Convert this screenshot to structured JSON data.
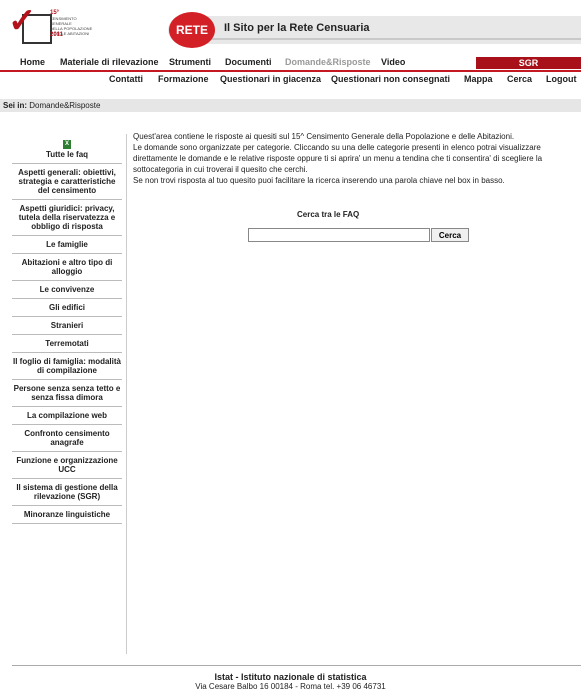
{
  "logo": {
    "top": "15°",
    "line1": "CENSIMENTO GENERALE",
    "line2": "DELLA POPOLAZIONE",
    "line3": "E DELLE ABITAZIONI",
    "year": "2011"
  },
  "site": {
    "rete": "RETE",
    "title": "Il Sito per la Rete Censuaria"
  },
  "nav1": [
    "Home",
    "Materiale di rilevazione",
    "Strumenti",
    "Documenti",
    "Domande&Risposte",
    "Video"
  ],
  "sgr": "SGR",
  "nav2": [
    "Contatti",
    "Formazione",
    "Questionari in giacenza",
    "Questionari non consegnati",
    "Mappa",
    "Cerca",
    "Logout"
  ],
  "breadcrumb": {
    "label": "Sei in:",
    "value": "Domande&Risposte"
  },
  "sidebar": [
    "Tutte le faq",
    "Aspetti generali: obiettivi, strategia e caratteristiche del censimento",
    "Aspetti giuridici: privacy, tutela della riservatezza e obbligo di risposta",
    "Le famiglie",
    "Abitazioni e altro tipo di alloggio",
    "Le convivenze",
    "Gli edifici",
    "Stranieri",
    "Terremotati",
    "Il foglio di famiglia: modalità di compilazione",
    "Persone senza senza tetto e senza fissa dimora",
    "La compilazione web",
    "Confronto censimento anagrafe",
    "Funzione e organizzazione UCC",
    "Il sistema di gestione della rilevazione (SGR)",
    "Minoranze linguistiche"
  ],
  "content": {
    "p1": "Quest'area contiene le risposte ai quesiti sul 15^ Censimento Generale della Popolazione e delle Abitazioni.",
    "p2": "Le domande sono organizzate per categorie. Cliccando su una delle categorie presenti in elenco potrai visualizzare",
    "p3": "direttamente le domande e le relative risposte oppure ti si aprira' un menu a tendina che ti consentira' di scegliere la",
    "p4": "sottocategoria in cui troverai il quesito che cerchi.",
    "p5": "Se non trovi risposta al tuo quesito puoi facilitare la ricerca inserendo una parola chiave nel box in basso."
  },
  "search": {
    "title": "Cerca tra le FAQ",
    "value": "",
    "button": "Cerca"
  },
  "footer": {
    "title": "Istat - Istituto nazionale di statistica",
    "address": "Via Cesare Balbo 16 00184 - Roma tel. +39 06 46731"
  }
}
